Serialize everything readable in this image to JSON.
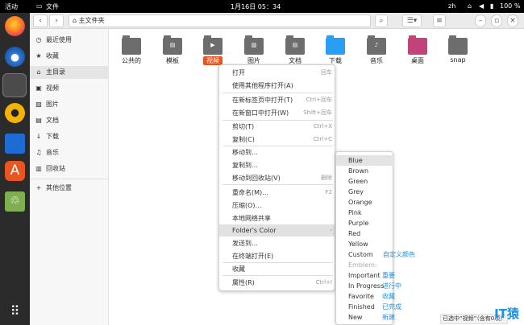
{
  "topbar": {
    "activities": "活动",
    "app_name": "文件",
    "clock": "1月16日 05：34",
    "lang": "zh",
    "battery": "100 %"
  },
  "header": {
    "path_label": "主文件夹"
  },
  "sidebar": {
    "items": [
      {
        "icon": "clock-icon",
        "label": "最近使用"
      },
      {
        "icon": "star-icon",
        "label": "收藏"
      },
      {
        "icon": "home-icon",
        "label": "主目录"
      },
      {
        "icon": "video-icon",
        "label": "视频"
      },
      {
        "icon": "image-icon",
        "label": "图片"
      },
      {
        "icon": "document-icon",
        "label": "文档"
      },
      {
        "icon": "download-icon",
        "label": "下载"
      },
      {
        "icon": "music-icon",
        "label": "音乐"
      },
      {
        "icon": "trash-icon",
        "label": "回收站"
      },
      {
        "icon": "plus-icon",
        "label": "其他位置"
      }
    ]
  },
  "folders": [
    {
      "label": "公共的",
      "color": "#6d6d6d",
      "glyph": ""
    },
    {
      "label": "模板",
      "color": "#6d6d6d",
      "glyph": "▤"
    },
    {
      "label": "视频",
      "color": "#6d6d6d",
      "glyph": "▶"
    },
    {
      "label": "图片",
      "color": "#6d6d6d",
      "glyph": "▨"
    },
    {
      "label": "文档",
      "color": "#6d6d6d",
      "glyph": "▤"
    },
    {
      "label": "下载",
      "color": "#2a9df4",
      "glyph": ""
    },
    {
      "label": "音乐",
      "color": "#6d6d6d",
      "glyph": "♪"
    },
    {
      "label": "桌面",
      "color": "#c0437a",
      "glyph": ""
    },
    {
      "label": "snap",
      "color": "#6d6d6d",
      "glyph": ""
    }
  ],
  "context_menu": [
    {
      "label": "打开",
      "shortcut": "回车"
    },
    {
      "label": "使用其他程序打开(A)",
      "shortcut": ""
    },
    {
      "label": "在新标签页中打开(T)",
      "shortcut": "Ctrl+回车"
    },
    {
      "label": "在新窗口中打开(W)",
      "shortcut": "Shift+回车"
    },
    {
      "label": "剪切(T)",
      "shortcut": "Ctrl+X"
    },
    {
      "label": "复制(C)",
      "shortcut": "Ctrl+C"
    },
    {
      "label": "移动到…",
      "shortcut": ""
    },
    {
      "label": "复制到…",
      "shortcut": ""
    },
    {
      "label": "移动到回收站(V)",
      "shortcut": "删除"
    },
    {
      "label": "重命名(M)…",
      "shortcut": "F2"
    },
    {
      "label": "压缩(O)…",
      "shortcut": ""
    },
    {
      "label": "本地网络共享",
      "shortcut": ""
    },
    {
      "label": "Folder's Color",
      "shortcut": "›"
    },
    {
      "label": "发送到…",
      "shortcut": ""
    },
    {
      "label": "在终端打开(E)",
      "shortcut": ""
    },
    {
      "label": "收藏",
      "shortcut": ""
    },
    {
      "label": "属性(R)",
      "shortcut": "Ctrl+I"
    }
  ],
  "submenu": [
    {
      "label": "Blue"
    },
    {
      "label": "Brown"
    },
    {
      "label": "Green"
    },
    {
      "label": "Grey"
    },
    {
      "label": "Orange"
    },
    {
      "label": "Pink"
    },
    {
      "label": "Purple"
    },
    {
      "label": "Red"
    },
    {
      "label": "Yellow"
    },
    {
      "label": "Custom"
    },
    {
      "label": "Emblem:"
    },
    {
      "label": "Important"
    },
    {
      "label": "In Progress"
    },
    {
      "label": "Favorite"
    },
    {
      "label": "Finished"
    },
    {
      "label": "New"
    }
  ],
  "annotations": [
    "自定义颜色",
    "重要",
    "进行中",
    "收藏",
    "已完成",
    "新建"
  ],
  "status": "已选中“视频”（含有0项）",
  "watermark": "IT猿",
  "colors": {
    "accent": "#e95420",
    "annotation": "#1f8fe0"
  }
}
